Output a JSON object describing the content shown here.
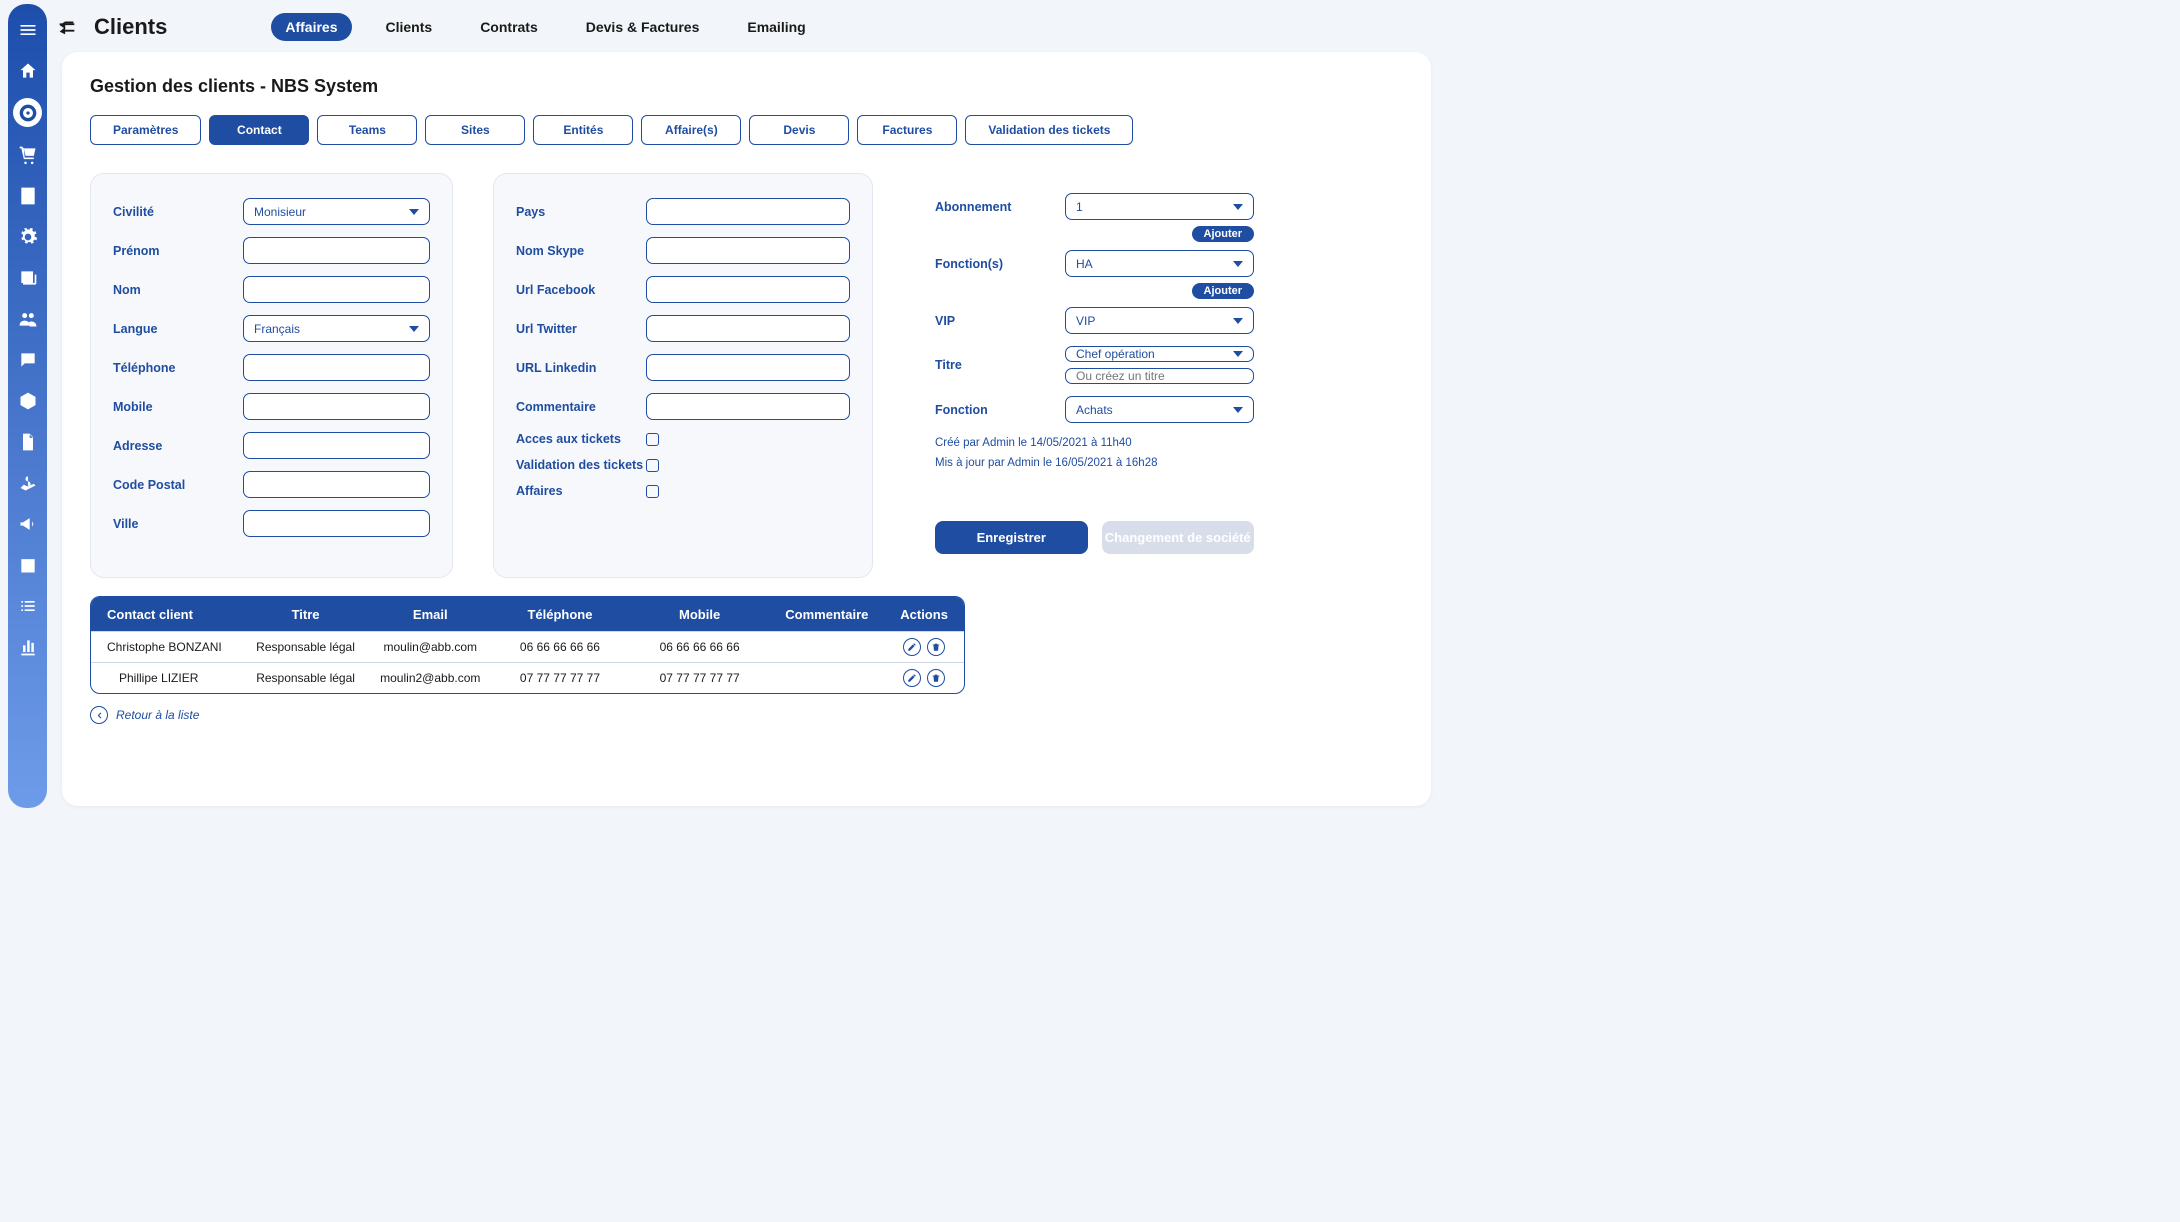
{
  "page": {
    "title": "Clients",
    "card_title": "Gestion des clients - NBS System"
  },
  "topnav": [
    {
      "label": "Affaires",
      "active": true
    },
    {
      "label": "Clients"
    },
    {
      "label": "Contrats"
    },
    {
      "label": "Devis & Factures"
    },
    {
      "label": "Emailing"
    }
  ],
  "tabs": [
    {
      "label": "Paramètres"
    },
    {
      "label": "Contact",
      "active": true
    },
    {
      "label": "Teams"
    },
    {
      "label": "Sites"
    },
    {
      "label": "Entités"
    },
    {
      "label": "Affaire(s)"
    },
    {
      "label": "Devis"
    },
    {
      "label": "Factures"
    },
    {
      "label": "Validation des tickets"
    }
  ],
  "form_left": {
    "civilite": {
      "label": "Civilité",
      "value": "Monisieur"
    },
    "prenom": {
      "label": "Prénom",
      "value": ""
    },
    "nom": {
      "label": "Nom",
      "value": ""
    },
    "langue": {
      "label": "Langue",
      "value": "Français"
    },
    "telephone": {
      "label": "Téléphone",
      "value": ""
    },
    "mobile": {
      "label": "Mobile",
      "value": ""
    },
    "adresse": {
      "label": "Adresse",
      "value": ""
    },
    "code_postal": {
      "label": "Code Postal",
      "value": ""
    },
    "ville": {
      "label": "Ville",
      "value": ""
    }
  },
  "form_mid": {
    "pays": {
      "label": "Pays",
      "value": ""
    },
    "skype": {
      "label": "Nom Skype",
      "value": ""
    },
    "facebook": {
      "label": "Url Facebook",
      "value": ""
    },
    "twitter": {
      "label": "Url Twitter",
      "value": ""
    },
    "linkedin": {
      "label": "URL Linkedin",
      "value": ""
    },
    "commentaire": {
      "label": "Commentaire",
      "value": ""
    },
    "acces_tickets": {
      "label": "Acces aux tickets"
    },
    "validation": {
      "label": "Validation des tickets"
    },
    "affaires": {
      "label": "Affaires"
    }
  },
  "form_right": {
    "abonnement": {
      "label": "Abonnement",
      "value": "1"
    },
    "fonctions": {
      "label": "Fonction(s)",
      "value": "HA"
    },
    "vip": {
      "label": "VIP",
      "value": "VIP"
    },
    "titre": {
      "label": "Titre",
      "value": "Chef opération"
    },
    "titre_alt": {
      "placeholder": "Ou créez un titre"
    },
    "fonction": {
      "label": "Fonction",
      "value": "Achats"
    },
    "add_btn": "Ajouter",
    "meta_line1": "Créé par Admin le 14/05/2021 à 11h40",
    "meta_line2": "Mis à jour par Admin le 16/05/2021 à 16h28"
  },
  "actions": {
    "save": "Enregistrer",
    "change_company": "Changement de société"
  },
  "table_headers": {
    "contact": "Contact client",
    "titre": "Titre",
    "email": "Email",
    "tel": "Téléphone",
    "mobile": "Mobile",
    "comm": "Commentaire",
    "actions": "Actions"
  },
  "table_rows": [
    {
      "contact": "Christophe BONZANI",
      "titre": "Responsable légal",
      "email": "moulin@abb.com",
      "tel": "06 66 66 66 66",
      "mobile": "06 66 66 66 66",
      "comm": ""
    },
    {
      "contact": "Phillipe LIZIER",
      "titre": "Responsable légal",
      "email": "moulin2@abb.com",
      "tel": "07 77 77 77 77",
      "mobile": "07 77 77 77 77",
      "comm": ""
    }
  ],
  "back_link": "Retour à la liste",
  "sidebar_icons": [
    "hamburger-icon",
    "home-icon",
    "target-icon",
    "cart-icon",
    "building-icon",
    "gear-icon",
    "newspaper-icon",
    "users-icon",
    "comment-icon",
    "package-icon",
    "file-icon",
    "hand-dollar-icon",
    "megaphone-icon",
    "calendar-icon",
    "list-icon",
    "chart-icon"
  ]
}
